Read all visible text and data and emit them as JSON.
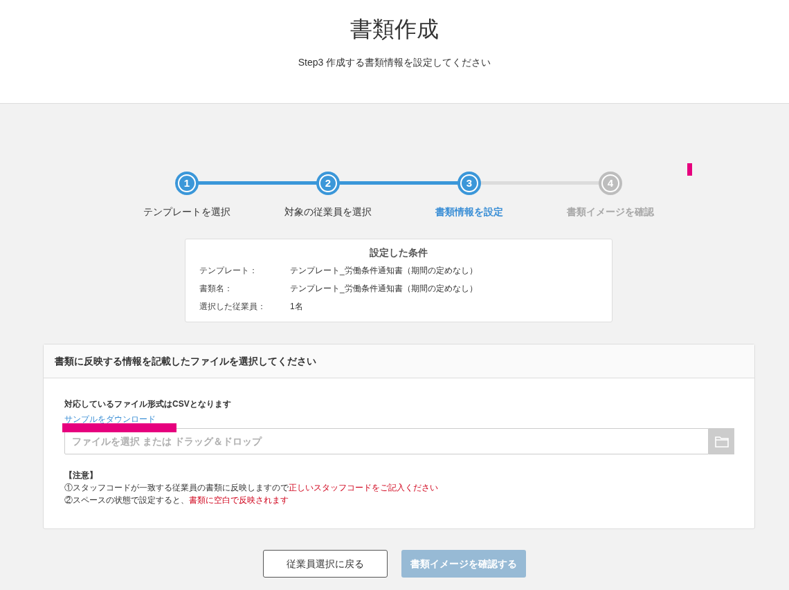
{
  "header": {
    "title": "書類作成",
    "subtitle": "Step3 作成する書類情報を設定してください"
  },
  "steps": [
    {
      "number": "1",
      "label": "テンプレートを選択",
      "reached": true,
      "selected": false
    },
    {
      "number": "2",
      "label": "対象の従業員を選択",
      "reached": true,
      "selected": false
    },
    {
      "number": "3",
      "label": "書類情報を設定",
      "reached": true,
      "selected": true
    },
    {
      "number": "4",
      "label": "書類イメージを確認",
      "reached": false,
      "selected": false
    }
  ],
  "conditions": {
    "title": "設定した条件",
    "rows": [
      {
        "label": "テンプレート：",
        "value": "テンプレート_労働条件通知書（期間の定めなし）"
      },
      {
        "label": "書類名：",
        "value": "テンプレート_労働条件通知書（期間の定めなし）"
      },
      {
        "label": "選択した従業員：",
        "value": "1名"
      }
    ]
  },
  "file_panel": {
    "title": "書類に反映する情報を記載したファイルを選択してください",
    "format_note": "対応しているファイル形式はCSVとなります",
    "sample_link": "サンプルをダウンロード",
    "file_field": {
      "placeholder": "ファイルを選択 または ドラッグ＆ドロップ"
    },
    "notice_heading": "【注意】",
    "notices": [
      {
        "parts": [
          {
            "text": "①スタッフコードが一致する従業員の書類に反映しますので",
            "emphasis": false
          },
          {
            "text": "正しいスタッフコードをご記入ください",
            "emphasis": true
          }
        ]
      },
      {
        "parts": [
          {
            "text": "②スペースの状態で設定すると、",
            "emphasis": false
          },
          {
            "text": "書類に空白で反映されます",
            "emphasis": true
          }
        ]
      }
    ]
  },
  "buttons": [
    {
      "label": "従業員選択に戻る",
      "disabled": false
    },
    {
      "label": "書類イメージを確認する",
      "disabled": true
    }
  ]
}
